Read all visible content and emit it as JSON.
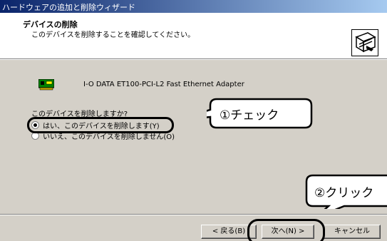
{
  "window": {
    "title": "ハードウェアの追加と削除ウィザード"
  },
  "header": {
    "title": "デバイスの削除",
    "subtitle": "このデバイスを削除することを確認してください。"
  },
  "device": {
    "name": "I-O DATA ET100-PCI-L2 Fast Ethernet Adapter"
  },
  "question": "このデバイスを削除しますか?",
  "options": [
    {
      "label": "はい、このデバイスを削除します(Y)",
      "selected": true
    },
    {
      "label": "いいえ、このデバイスを削除しません(O)",
      "selected": false
    }
  ],
  "annotations": {
    "step1": "①チェック",
    "step2": "②クリック"
  },
  "buttons": {
    "back": "< 戻る(B)",
    "next": "次へ(N) >",
    "cancel": "キャンセル"
  }
}
